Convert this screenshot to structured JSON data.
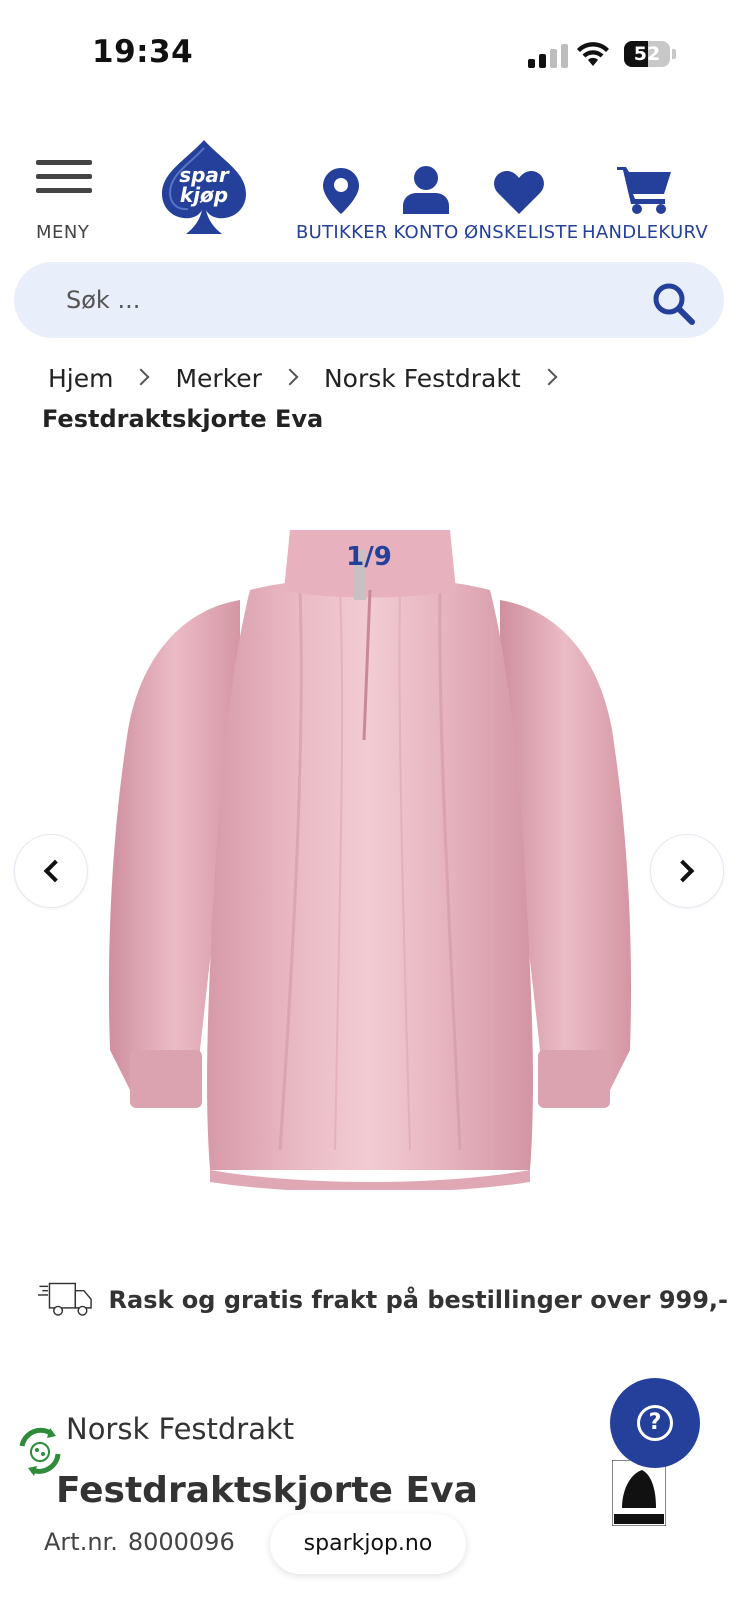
{
  "status_bar": {
    "time": "19:34",
    "battery": "52",
    "battery_level": 0.52
  },
  "header": {
    "menu_label": "MENY",
    "logo_text": "spar kjøp",
    "nav": [
      {
        "label": "BUTIKKER",
        "icon": "location-pin-icon"
      },
      {
        "label": "KONTO",
        "icon": "user-icon"
      },
      {
        "label": "ØNSKELISTE",
        "icon": "heart-icon"
      },
      {
        "label": "HANDLEKURV",
        "icon": "cart-icon"
      }
    ]
  },
  "search": {
    "placeholder": "Søk ..."
  },
  "breadcrumb": {
    "items": [
      "Hjem",
      "Merker",
      "Norsk Festdrakt"
    ],
    "current": "Festdraktskjorte Eva"
  },
  "gallery": {
    "counter": "1/9"
  },
  "shipping": {
    "text": "Rask og gratis frakt på bestillinger over 999,-"
  },
  "product": {
    "brand": "Norsk Festdrakt",
    "title": "Festdraktskjorte Eva",
    "artnr_label": "Art.nr.",
    "artnr_value": "8000096"
  },
  "footer": {
    "url": "sparkjop.no"
  },
  "colors": {
    "brand_blue": "#25409a",
    "search_bg": "#e9effa",
    "blouse_pink": "#e6b3bd"
  }
}
